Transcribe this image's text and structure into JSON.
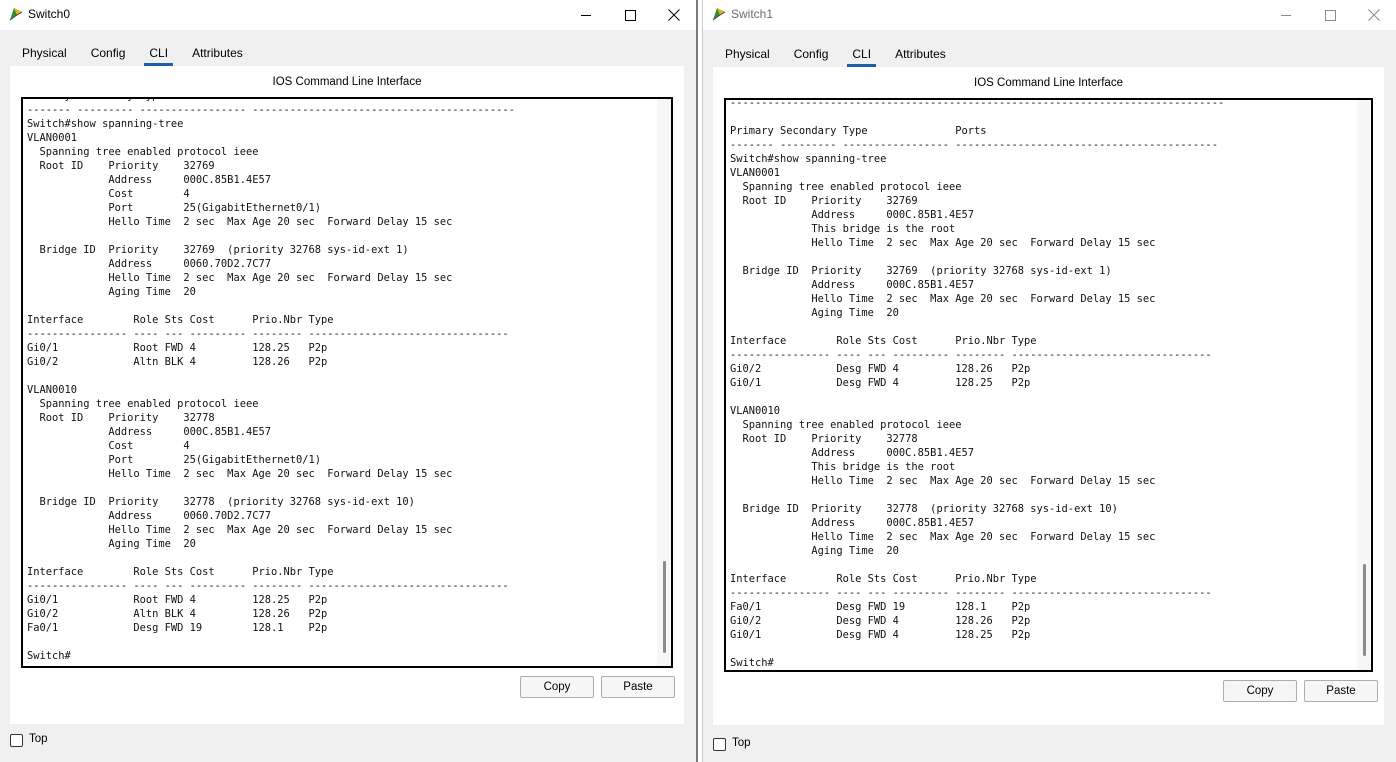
{
  "windows": [
    {
      "title": "Switch0",
      "tabs": [
        "Physical",
        "Config",
        "CLI",
        "Attributes"
      ],
      "active_tab": "CLI",
      "heading": "IOS Command Line Interface",
      "terminal_lines": [
        "Primary Secondary Type              Ports",
        "------- --------- ----------------- ------------------------------------------",
        "Switch#show spanning-tree",
        "VLAN0001",
        "  Spanning tree enabled protocol ieee",
        "  Root ID    Priority    32769",
        "             Address     000C.85B1.4E57",
        "             Cost        4",
        "             Port        25(GigabitEthernet0/1)",
        "             Hello Time  2 sec  Max Age 20 sec  Forward Delay 15 sec",
        "",
        "  Bridge ID  Priority    32769  (priority 32768 sys-id-ext 1)",
        "             Address     0060.70D2.7C77",
        "             Hello Time  2 sec  Max Age 20 sec  Forward Delay 15 sec",
        "             Aging Time  20",
        "",
        "Interface        Role Sts Cost      Prio.Nbr Type",
        "---------------- ---- --- --------- -------- --------------------------------",
        "Gi0/1            Root FWD 4         128.25   P2p",
        "Gi0/2            Altn BLK 4         128.26   P2p",
        "",
        "VLAN0010",
        "  Spanning tree enabled protocol ieee",
        "  Root ID    Priority    32778",
        "             Address     000C.85B1.4E57",
        "             Cost        4",
        "             Port        25(GigabitEthernet0/1)",
        "             Hello Time  2 sec  Max Age 20 sec  Forward Delay 15 sec",
        "",
        "  Bridge ID  Priority    32778  (priority 32768 sys-id-ext 10)",
        "             Address     0060.70D2.7C77",
        "             Hello Time  2 sec  Max Age 20 sec  Forward Delay 15 sec",
        "             Aging Time  20",
        "",
        "Interface        Role Sts Cost      Prio.Nbr Type",
        "---------------- ---- --- --------- -------- --------------------------------",
        "Gi0/1            Root FWD 4         128.25   P2p",
        "Gi0/2            Altn BLK 4         128.26   P2p",
        "Fa0/1            Desg FWD 19        128.1    P2p",
        "",
        "Switch#"
      ],
      "copy_label": "Copy",
      "paste_label": "Paste",
      "top_label": "Top"
    },
    {
      "title": "Switch1",
      "tabs": [
        "Physical",
        "Config",
        "CLI",
        "Attributes"
      ],
      "active_tab": "CLI",
      "heading": "IOS Command Line Interface",
      "terminal_lines": [
        "-------------------------------------------------------------------------------",
        "",
        "Primary Secondary Type              Ports",
        "------- --------- ----------------- ------------------------------------------",
        "Switch#show spanning-tree",
        "VLAN0001",
        "  Spanning tree enabled protocol ieee",
        "  Root ID    Priority    32769",
        "             Address     000C.85B1.4E57",
        "             This bridge is the root",
        "             Hello Time  2 sec  Max Age 20 sec  Forward Delay 15 sec",
        "",
        "  Bridge ID  Priority    32769  (priority 32768 sys-id-ext 1)",
        "             Address     000C.85B1.4E57",
        "             Hello Time  2 sec  Max Age 20 sec  Forward Delay 15 sec",
        "             Aging Time  20",
        "",
        "Interface        Role Sts Cost      Prio.Nbr Type",
        "---------------- ---- --- --------- -------- --------------------------------",
        "Gi0/2            Desg FWD 4         128.26   P2p",
        "Gi0/1            Desg FWD 4         128.25   P2p",
        "",
        "VLAN0010",
        "  Spanning tree enabled protocol ieee",
        "  Root ID    Priority    32778",
        "             Address     000C.85B1.4E57",
        "             This bridge is the root",
        "             Hello Time  2 sec  Max Age 20 sec  Forward Delay 15 sec",
        "",
        "  Bridge ID  Priority    32778  (priority 32768 sys-id-ext 10)",
        "             Address     000C.85B1.4E57",
        "             Hello Time  2 sec  Max Age 20 sec  Forward Delay 15 sec",
        "             Aging Time  20",
        "",
        "Interface        Role Sts Cost      Prio.Nbr Type",
        "---------------- ---- --- --------- -------- --------------------------------",
        "Fa0/1            Desg FWD 19        128.1    P2p",
        "Gi0/2            Desg FWD 4         128.26   P2p",
        "Gi0/1            Desg FWD 4         128.25   P2p",
        "",
        "Switch#"
      ],
      "copy_label": "Copy",
      "paste_label": "Paste",
      "top_label": "Top"
    }
  ],
  "colors": {
    "accent": "#1c5fa8",
    "window_bg": "#f0f0f0",
    "inactive_title": "#6d6d6d"
  },
  "icons": [
    "app-icon",
    "minimize-icon",
    "maximize-icon",
    "close-icon"
  ]
}
